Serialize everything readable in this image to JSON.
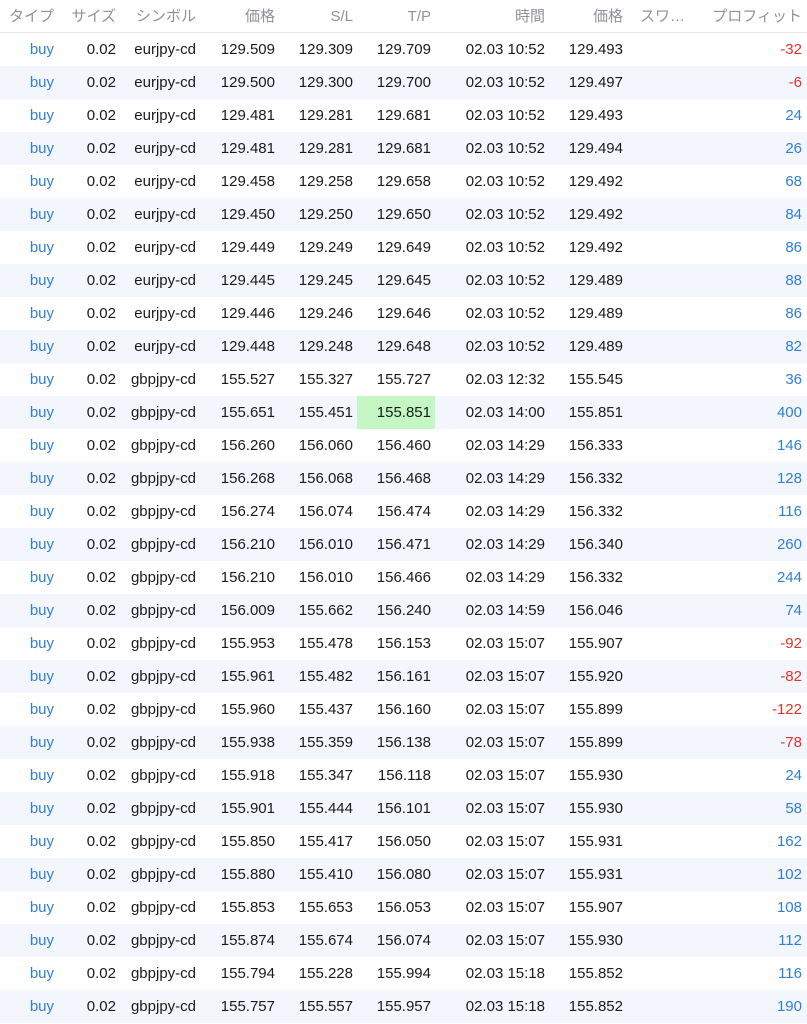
{
  "headers": {
    "type": "タイプ",
    "size": "サイズ",
    "symbol": "シンボル",
    "price": "価格",
    "sl": "S/L",
    "tp": "T/P",
    "time": "時間",
    "current_price": "価格",
    "swap": "スワ…",
    "profit": "プロフィット"
  },
  "colors": {
    "positive": "#2f7fd6",
    "negative": "#e0342b",
    "tp_highlight": "#c4f7c4",
    "alt_row": "#f3f6fc"
  },
  "rows": [
    {
      "type": "buy",
      "size": "0.02",
      "symbol": "eurjpy-cd",
      "price": "129.509",
      "sl": "129.309",
      "tp": "129.709",
      "time": "02.03 10:52",
      "current": "129.493",
      "swap": "",
      "profit": "-32"
    },
    {
      "type": "buy",
      "size": "0.02",
      "symbol": "eurjpy-cd",
      "price": "129.500",
      "sl": "129.300",
      "tp": "129.700",
      "time": "02.03 10:52",
      "current": "129.497",
      "swap": "",
      "profit": "-6"
    },
    {
      "type": "buy",
      "size": "0.02",
      "symbol": "eurjpy-cd",
      "price": "129.481",
      "sl": "129.281",
      "tp": "129.681",
      "time": "02.03 10:52",
      "current": "129.493",
      "swap": "",
      "profit": "24"
    },
    {
      "type": "buy",
      "size": "0.02",
      "symbol": "eurjpy-cd",
      "price": "129.481",
      "sl": "129.281",
      "tp": "129.681",
      "time": "02.03 10:52",
      "current": "129.494",
      "swap": "",
      "profit": "26"
    },
    {
      "type": "buy",
      "size": "0.02",
      "symbol": "eurjpy-cd",
      "price": "129.458",
      "sl": "129.258",
      "tp": "129.658",
      "time": "02.03 10:52",
      "current": "129.492",
      "swap": "",
      "profit": "68"
    },
    {
      "type": "buy",
      "size": "0.02",
      "symbol": "eurjpy-cd",
      "price": "129.450",
      "sl": "129.250",
      "tp": "129.650",
      "time": "02.03 10:52",
      "current": "129.492",
      "swap": "",
      "profit": "84"
    },
    {
      "type": "buy",
      "size": "0.02",
      "symbol": "eurjpy-cd",
      "price": "129.449",
      "sl": "129.249",
      "tp": "129.649",
      "time": "02.03 10:52",
      "current": "129.492",
      "swap": "",
      "profit": "86"
    },
    {
      "type": "buy",
      "size": "0.02",
      "symbol": "eurjpy-cd",
      "price": "129.445",
      "sl": "129.245",
      "tp": "129.645",
      "time": "02.03 10:52",
      "current": "129.489",
      "swap": "",
      "profit": "88"
    },
    {
      "type": "buy",
      "size": "0.02",
      "symbol": "eurjpy-cd",
      "price": "129.446",
      "sl": "129.246",
      "tp": "129.646",
      "time": "02.03 10:52",
      "current": "129.489",
      "swap": "",
      "profit": "86"
    },
    {
      "type": "buy",
      "size": "0.02",
      "symbol": "eurjpy-cd",
      "price": "129.448",
      "sl": "129.248",
      "tp": "129.648",
      "time": "02.03 10:52",
      "current": "129.489",
      "swap": "",
      "profit": "82"
    },
    {
      "type": "buy",
      "size": "0.02",
      "symbol": "gbpjpy-cd",
      "price": "155.527",
      "sl": "155.327",
      "tp": "155.727",
      "time": "02.03 12:32",
      "current": "155.545",
      "swap": "",
      "profit": "36"
    },
    {
      "type": "buy",
      "size": "0.02",
      "symbol": "gbpjpy-cd",
      "price": "155.651",
      "sl": "155.451",
      "tp": "155.851",
      "time": "02.03 14:00",
      "current": "155.851",
      "swap": "",
      "profit": "400",
      "tp_hit": true
    },
    {
      "type": "buy",
      "size": "0.02",
      "symbol": "gbpjpy-cd",
      "price": "156.260",
      "sl": "156.060",
      "tp": "156.460",
      "time": "02.03 14:29",
      "current": "156.333",
      "swap": "",
      "profit": "146"
    },
    {
      "type": "buy",
      "size": "0.02",
      "symbol": "gbpjpy-cd",
      "price": "156.268",
      "sl": "156.068",
      "tp": "156.468",
      "time": "02.03 14:29",
      "current": "156.332",
      "swap": "",
      "profit": "128"
    },
    {
      "type": "buy",
      "size": "0.02",
      "symbol": "gbpjpy-cd",
      "price": "156.274",
      "sl": "156.074",
      "tp": "156.474",
      "time": "02.03 14:29",
      "current": "156.332",
      "swap": "",
      "profit": "116"
    },
    {
      "type": "buy",
      "size": "0.02",
      "symbol": "gbpjpy-cd",
      "price": "156.210",
      "sl": "156.010",
      "tp": "156.471",
      "time": "02.03 14:29",
      "current": "156.340",
      "swap": "",
      "profit": "260"
    },
    {
      "type": "buy",
      "size": "0.02",
      "symbol": "gbpjpy-cd",
      "price": "156.210",
      "sl": "156.010",
      "tp": "156.466",
      "time": "02.03 14:29",
      "current": "156.332",
      "swap": "",
      "profit": "244"
    },
    {
      "type": "buy",
      "size": "0.02",
      "symbol": "gbpjpy-cd",
      "price": "156.009",
      "sl": "155.662",
      "tp": "156.240",
      "time": "02.03 14:59",
      "current": "156.046",
      "swap": "",
      "profit": "74"
    },
    {
      "type": "buy",
      "size": "0.02",
      "symbol": "gbpjpy-cd",
      "price": "155.953",
      "sl": "155.478",
      "tp": "156.153",
      "time": "02.03 15:07",
      "current": "155.907",
      "swap": "",
      "profit": "-92"
    },
    {
      "type": "buy",
      "size": "0.02",
      "symbol": "gbpjpy-cd",
      "price": "155.961",
      "sl": "155.482",
      "tp": "156.161",
      "time": "02.03 15:07",
      "current": "155.920",
      "swap": "",
      "profit": "-82"
    },
    {
      "type": "buy",
      "size": "0.02",
      "symbol": "gbpjpy-cd",
      "price": "155.960",
      "sl": "155.437",
      "tp": "156.160",
      "time": "02.03 15:07",
      "current": "155.899",
      "swap": "",
      "profit": "-122"
    },
    {
      "type": "buy",
      "size": "0.02",
      "symbol": "gbpjpy-cd",
      "price": "155.938",
      "sl": "155.359",
      "tp": "156.138",
      "time": "02.03 15:07",
      "current": "155.899",
      "swap": "",
      "profit": "-78"
    },
    {
      "type": "buy",
      "size": "0.02",
      "symbol": "gbpjpy-cd",
      "price": "155.918",
      "sl": "155.347",
      "tp": "156.118",
      "time": "02.03 15:07",
      "current": "155.930",
      "swap": "",
      "profit": "24"
    },
    {
      "type": "buy",
      "size": "0.02",
      "symbol": "gbpjpy-cd",
      "price": "155.901",
      "sl": "155.444",
      "tp": "156.101",
      "time": "02.03 15:07",
      "current": "155.930",
      "swap": "",
      "profit": "58"
    },
    {
      "type": "buy",
      "size": "0.02",
      "symbol": "gbpjpy-cd",
      "price": "155.850",
      "sl": "155.417",
      "tp": "156.050",
      "time": "02.03 15:07",
      "current": "155.931",
      "swap": "",
      "profit": "162"
    },
    {
      "type": "buy",
      "size": "0.02",
      "symbol": "gbpjpy-cd",
      "price": "155.880",
      "sl": "155.410",
      "tp": "156.080",
      "time": "02.03 15:07",
      "current": "155.931",
      "swap": "",
      "profit": "102"
    },
    {
      "type": "buy",
      "size": "0.02",
      "symbol": "gbpjpy-cd",
      "price": "155.853",
      "sl": "155.653",
      "tp": "156.053",
      "time": "02.03 15:07",
      "current": "155.907",
      "swap": "",
      "profit": "108"
    },
    {
      "type": "buy",
      "size": "0.02",
      "symbol": "gbpjpy-cd",
      "price": "155.874",
      "sl": "155.674",
      "tp": "156.074",
      "time": "02.03 15:07",
      "current": "155.930",
      "swap": "",
      "profit": "112"
    },
    {
      "type": "buy",
      "size": "0.02",
      "symbol": "gbpjpy-cd",
      "price": "155.794",
      "sl": "155.228",
      "tp": "155.994",
      "time": "02.03 15:18",
      "current": "155.852",
      "swap": "",
      "profit": "116"
    },
    {
      "type": "buy",
      "size": "0.02",
      "symbol": "gbpjpy-cd",
      "price": "155.757",
      "sl": "155.557",
      "tp": "155.957",
      "time": "02.03 15:18",
      "current": "155.852",
      "swap": "",
      "profit": "190"
    }
  ]
}
